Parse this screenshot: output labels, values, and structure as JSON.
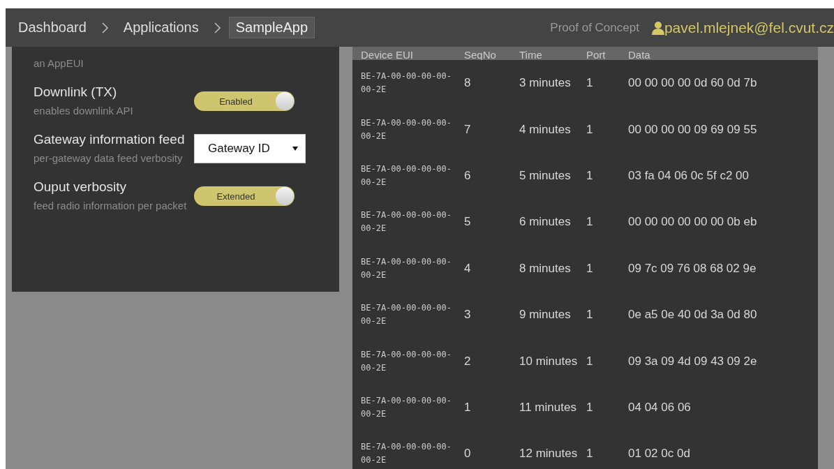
{
  "breadcrumbs": [
    {
      "label": "Dashboard",
      "selected": false
    },
    {
      "label": "Applications",
      "selected": false
    },
    {
      "label": "SampleApp",
      "selected": true
    }
  ],
  "header": {
    "tagline": "Proof of Concept",
    "user": "pavel.mlejnek@fel.cvut.cz"
  },
  "settings": {
    "intro": "an AppEUI",
    "items": [
      {
        "kind": "toggle",
        "label": "Downlink (TX)",
        "description": "enables downlink API",
        "value": "Enabled",
        "on": true
      },
      {
        "kind": "select",
        "label": "Gateway information feed",
        "description": "per-gateway data feed verbosity",
        "value": "Gateway ID"
      },
      {
        "kind": "toggle",
        "label": "Ouput verbosity",
        "description": "feed radio information per packet",
        "value": "Extended",
        "on": true
      }
    ]
  },
  "table": {
    "columns": [
      "Device EUI",
      "SeqNo",
      "Time",
      "Port",
      "Data"
    ],
    "rows": [
      [
        "BE-7A-00-00-00-00-00-2E",
        "8",
        "3 minutes",
        "1",
        "00 00 00 00 0d 60 0d 7b"
      ],
      [
        "BE-7A-00-00-00-00-00-2E",
        "7",
        "4 minutes",
        "1",
        "00 00 00 00 09 69 09 55"
      ],
      [
        "BE-7A-00-00-00-00-00-2E",
        "6",
        "5 minutes",
        "1",
        "03 fa 04 06 0c 5f c2 00"
      ],
      [
        "BE-7A-00-00-00-00-00-2E",
        "5",
        "6 minutes",
        "1",
        "00 00 00 00 00 00 0b eb"
      ],
      [
        "BE-7A-00-00-00-00-00-2E",
        "4",
        "8 minutes",
        "1",
        "09 7c 09 76 08 68 02 9e"
      ],
      [
        "BE-7A-00-00-00-00-00-2E",
        "3",
        "9 minutes",
        "1",
        "0e a5 0e 40 0d 3a 0d 80"
      ],
      [
        "BE-7A-00-00-00-00-00-2E",
        "2",
        "10 minutes",
        "1",
        "09 3a 09 4d 09 43 09 2e"
      ],
      [
        "BE-7A-00-00-00-00-00-2E",
        "1",
        "11 minutes",
        "1",
        "04 04 06 06"
      ],
      [
        "BE-7A-00-00-00-00-00-2E",
        "0",
        "12 minutes",
        "1",
        "01 02 0c 0d"
      ]
    ]
  }
}
